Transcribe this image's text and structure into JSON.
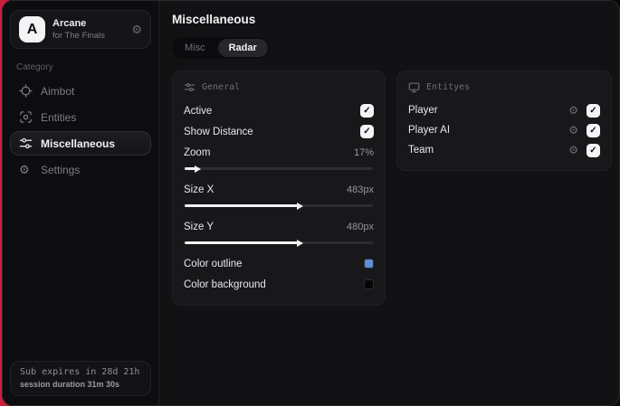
{
  "icons": {
    "gear": "⚙",
    "check": "✓"
  },
  "window": {
    "accent_edge_color": "#cf1d3e"
  },
  "sidebar": {
    "logo_letter": "A",
    "app_name": "Arcane",
    "app_subtitle": "for The Finals",
    "category_label": "Category",
    "items": [
      {
        "label": "Aimbot",
        "icon": "crosshair-icon",
        "active": false
      },
      {
        "label": "Entities",
        "icon": "scan-icon",
        "active": false
      },
      {
        "label": "Miscellaneous",
        "icon": "sliders-icon",
        "active": true
      },
      {
        "label": "Settings",
        "icon": "gear-icon",
        "active": false
      }
    ],
    "footer": {
      "line1": "Sub expires in 28d 21h",
      "line2": "session duration 31m 30s"
    }
  },
  "main": {
    "title": "Miscellaneous",
    "tabs": [
      {
        "label": "Misc",
        "active": false
      },
      {
        "label": "Radar",
        "active": true
      }
    ],
    "general": {
      "title": "General",
      "active_label": "Active",
      "active_checked": true,
      "show_distance_label": "Show Distance",
      "show_distance_checked": true,
      "zoom_label": "Zoom",
      "zoom_value": "17%",
      "zoom_fill_pct": "6",
      "size_x_label": "Size X",
      "size_x_value": "483px",
      "size_x_fill_pct": "60",
      "size_y_label": "Size Y",
      "size_y_value": "480px",
      "size_y_fill_pct": "60",
      "color_outline_label": "Color outline",
      "color_outline_value": "#5b8fd8",
      "color_background_label": "Color background",
      "color_background_value": "#050505"
    },
    "entities": {
      "title": "Entityes",
      "rows": [
        {
          "label": "Player",
          "checked": true
        },
        {
          "label": "Player AI",
          "checked": true
        },
        {
          "label": "Team",
          "checked": true
        }
      ]
    }
  }
}
